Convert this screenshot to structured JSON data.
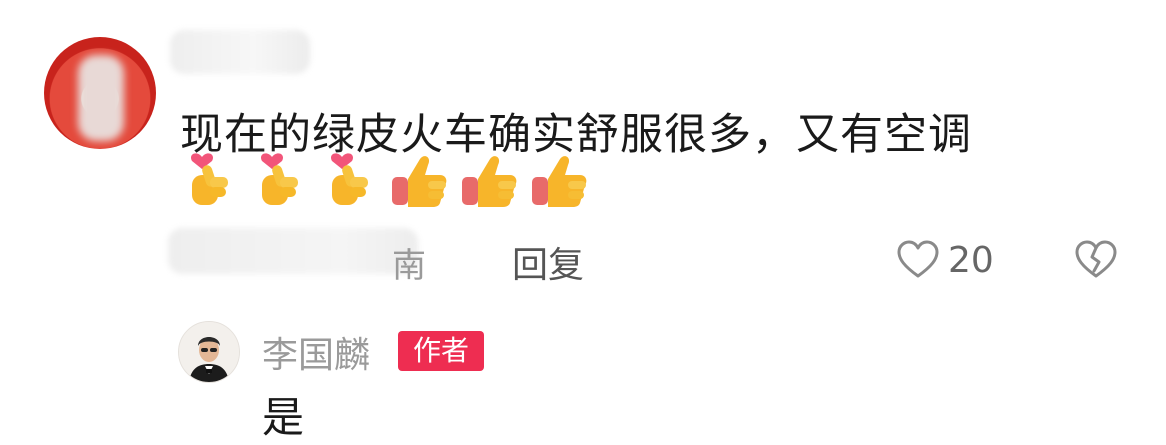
{
  "comment": {
    "text": "现在的绿皮火车确实舒服很多，又有空调",
    "emojis": [
      "finger-heart-icon",
      "finger-heart-icon",
      "finger-heart-icon",
      "thumbs-up-icon",
      "thumbs-up-icon",
      "thumbs-up-icon"
    ],
    "location_suffix": "南",
    "reply_label": "回复",
    "like_count": "20"
  },
  "reply": {
    "username": "李国麟",
    "badge": "作者",
    "text": "是"
  },
  "colors": {
    "badge_bg": "#ee2d51",
    "text_primary": "#1a1a1a",
    "text_muted": "#9a9a9a"
  }
}
